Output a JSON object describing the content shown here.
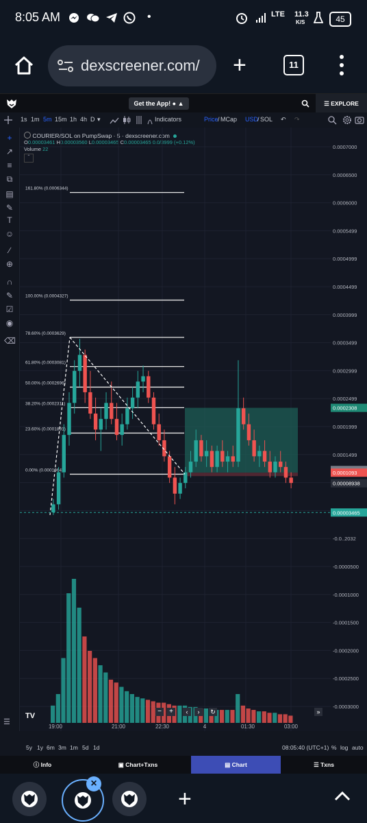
{
  "status_bar": {
    "time": "8:05 AM",
    "network": "LTE",
    "speed_value": "11.3",
    "speed_unit": "K/S",
    "battery": "45"
  },
  "browser": {
    "url": "dexscreener.com/",
    "tab_count": "11"
  },
  "dex_header": {
    "get_app_label": "Get the App!",
    "explore_label": "EXPLORE"
  },
  "toolbar": {
    "timeframes": [
      "1s",
      "1m",
      "5m",
      "15m",
      "1h",
      "4h",
      "D"
    ],
    "active_timeframe": "5m",
    "indicators_label": "Indicators",
    "price_label": "Price",
    "mcap_label": "MCap",
    "usd_label": "USD",
    "sol_label": "SOL"
  },
  "chart_info": {
    "pair": "COURIER/SOL on PumpSwap · 5 · dexscreener.com",
    "o_label": "O",
    "o": "0.00003461",
    "h_label": "H",
    "h": "0.00003560",
    "l_label": "L",
    "l": "0.00003465",
    "c_label": "C",
    "c": "0.00003465",
    "change": "0.0/3999 (+0.12%)",
    "volume_label": "Volume",
    "volume": "22"
  },
  "fib_levels": [
    {
      "label": "161.80% (0.0006344)",
      "value": 0.0006344
    },
    {
      "label": "100.00% (0.0004327)",
      "value": 0.0004327
    },
    {
      "label": "78.60% (0.0003629)",
      "value": 0.0003629
    },
    {
      "label": "61.80% (0.0003081)",
      "value": 0.0003081
    },
    {
      "label": "50.00% (0.0002696)",
      "value": 0.0002696
    },
    {
      "label": "38.20% (0.0002311)",
      "value": 0.0002311
    },
    {
      "label": "23.60% (0.0001891)",
      "value": 0.0001835
    },
    {
      "label": "0.00% (0.0001064)",
      "value": 0.0001064
    }
  ],
  "price_axis": {
    "ticks": [
      "0.0007000",
      "0.0006500",
      "0.0006000",
      "0.0005499",
      "0.0004999",
      "0.0004499",
      "0.0003999",
      "0.0003499",
      "0.0002999",
      "0.0002499",
      "0.0001999",
      "0.0001499",
      "0.00009999",
      "0.00004999",
      "-0.0..2032",
      "-0.0000500",
      "-0.0001000",
      "-0.0001500",
      "-0.0002000",
      "-0.0002500",
      "-0.0003000"
    ],
    "badge_green_1": "0.0002308",
    "badge_grey": "0.0001143",
    "badge_red": "0.0001093",
    "badge_blue": "0.00008938",
    "badge_green_2": "0.00003465"
  },
  "time_axis": [
    "19:00",
    "21:00",
    "22:30",
    "4",
    "01:30",
    "03:00"
  ],
  "bottom_bar": {
    "ranges": [
      "5y",
      "1y",
      "6m",
      "3m",
      "1m",
      "5d",
      "1d"
    ],
    "clock": "08:05:40 (UTC+1)",
    "percent_label": "%",
    "log_label": "log",
    "auto_label": "auto"
  },
  "bottom_tabs": [
    {
      "label": "Info"
    },
    {
      "label": "Chart+Txns"
    },
    {
      "label": "Chart"
    },
    {
      "label": "Txns"
    }
  ],
  "colors": {
    "bg": "#131722",
    "up": "#26a69a",
    "down": "#ef5350",
    "accent": "#2962ff",
    "active_tab": "#3d4db5",
    "position_zone": "#1d5d55"
  },
  "chart_data": {
    "type": "candlestick",
    "ylim": [
      -0.00033,
      0.00072
    ],
    "log": false,
    "grid": true,
    "candles": [
      [
        3.5e-05,
        6e-05,
        3e-05,
        5e-05
      ],
      [
        5e-05,
        0.00012,
        4e-05,
        0.00011
      ],
      [
        0.00011,
        0.0002,
        0.0001,
        0.00018
      ],
      [
        0.00018,
        0.00026,
        0.00016,
        0.00024
      ],
      [
        0.00024,
        0.00032,
        0.00022,
        0.0003
      ],
      [
        0.0003,
        0.00036,
        0.00027,
        0.00033
      ],
      [
        0.00033,
        0.00034,
        0.00024,
        0.00026
      ],
      [
        0.00026,
        0.0003,
        0.00021,
        0.00022
      ],
      [
        0.00022,
        0.00025,
        0.00017,
        0.00019
      ],
      [
        0.00019,
        0.00023,
        0.00015,
        0.00021
      ],
      [
        0.00021,
        0.00026,
        0.00019,
        0.00024
      ],
      [
        0.00024,
        0.00028,
        0.0002,
        0.00021
      ],
      [
        0.00021,
        0.00024,
        0.00017,
        0.00018
      ],
      [
        0.00018,
        0.00022,
        0.00016,
        0.0002
      ],
      [
        0.0002,
        0.00025,
        0.00019,
        0.00023
      ],
      [
        0.00023,
        0.00027,
        0.00021,
        0.00025
      ],
      [
        0.00025,
        0.0003,
        0.00023,
        0.00028
      ],
      [
        0.00028,
        0.00031,
        0.00026,
        0.00029
      ],
      [
        0.00029,
        0.0003,
        0.00024,
        0.00025
      ],
      [
        0.00025,
        0.00026,
        0.00019,
        0.0002
      ],
      [
        0.0002,
        0.00022,
        0.00016,
        0.00017
      ],
      [
        0.00017,
        0.00019,
        0.00013,
        0.00014
      ],
      [
        0.00014,
        0.00015,
        9e-05,
        0.0001
      ],
      [
        0.0001,
        0.00012,
        5e-05,
        7e-05
      ],
      [
        7e-05,
        0.0001,
        6e-05,
        9e-05
      ],
      [
        9e-05,
        0.00012,
        8e-05,
        0.00011
      ],
      [
        0.00011,
        0.00015,
        0.0001,
        0.00013
      ],
      [
        0.00013,
        0.00019,
        0.00012,
        0.00017
      ],
      [
        0.00017,
        0.00018,
        0.00013,
        0.00014
      ],
      [
        0.00014,
        0.00017,
        0.00012,
        0.00015
      ],
      [
        0.00015,
        0.00016,
        0.00011,
        0.00012
      ],
      [
        0.00012,
        0.00016,
        0.00011,
        0.00015
      ],
      [
        0.00015,
        0.00017,
        0.00012,
        0.00013
      ],
      [
        0.00013,
        0.00015,
        0.00011,
        0.00014
      ],
      [
        0.00014,
        0.00016,
        0.00012,
        0.00013
      ],
      [
        0.00013,
        0.00032,
        0.00012,
        0.00023
      ],
      [
        0.00023,
        0.00025,
        0.00019,
        0.0002
      ],
      [
        0.0002,
        0.00022,
        0.00016,
        0.00017
      ],
      [
        0.00017,
        0.00019,
        0.00013,
        0.00014
      ],
      [
        0.00014,
        0.00016,
        0.00012,
        0.00015
      ],
      [
        0.00015,
        0.00017,
        0.00012,
        0.00013
      ],
      [
        0.00013,
        0.00015,
        0.0001,
        0.00011
      ],
      [
        0.00011,
        0.00014,
        0.0001,
        0.00013
      ],
      [
        0.00013,
        0.00015,
        0.00011,
        0.00012
      ],
      [
        0.00012,
        0.00013,
        9e-05,
        0.0001
      ],
      [
        0.0001,
        0.00011,
        8e-05,
        9e-05
      ]
    ],
    "volumes": [
      12,
      20,
      45,
      90,
      100,
      80,
      60,
      50,
      45,
      40,
      35,
      30,
      28,
      25,
      22,
      20,
      18,
      17,
      16,
      15,
      14,
      14,
      13,
      12,
      12,
      12,
      11,
      11,
      10,
      10,
      10,
      9,
      9,
      9,
      9,
      20,
      12,
      10,
      9,
      8,
      8,
      7,
      7,
      6,
      6,
      5
    ]
  }
}
